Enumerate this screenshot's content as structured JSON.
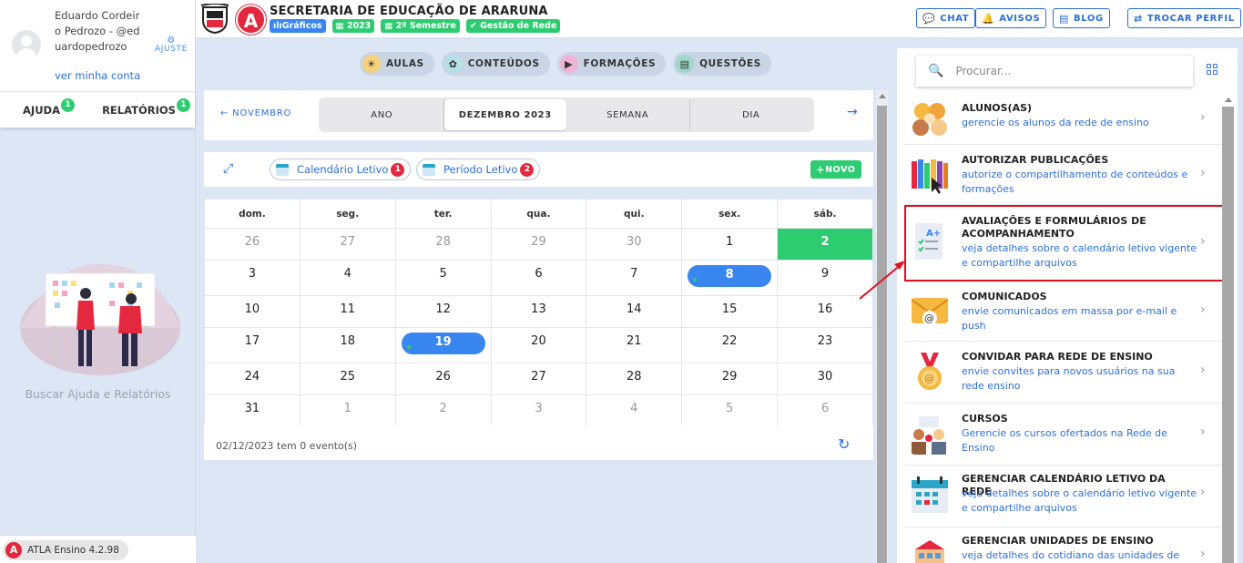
{
  "user": {
    "name_line": "Eduardo Cordeiro Pedrozo - @eduardopedrozo",
    "account_link": "ver minha conta",
    "adjust_label": "AJUSTE"
  },
  "left_tabs": [
    {
      "label": "AJUDA",
      "badge": "1"
    },
    {
      "label": "RELATÓRIOS",
      "badge": "1"
    }
  ],
  "left_help_text": "Buscar Ajuda e Relatórios",
  "version_label": "ATLA Ensino 4.2.98",
  "header": {
    "logo_letter": "A",
    "title": "SECRETARIA DE EDUCAÇÃO DE ARARUNA",
    "badges": [
      "Gráficos",
      "2023",
      "2º Semestre",
      "Gestão de Rede"
    ],
    "buttons": [
      "CHAT",
      "AVISOS",
      "BLOG",
      "TROCAR PERFIL"
    ]
  },
  "content_tabs": [
    "AULAS",
    "CONTEÚDOS",
    "FORMAÇÕES",
    "QUESTÕES"
  ],
  "calendar": {
    "prev_label": "NOVEMBRO",
    "view_segments": [
      "ANO",
      "DEZEMBRO 2023",
      "SEMANA",
      "DIA"
    ],
    "active_segment": "DEZEMBRO 2023",
    "chips": [
      {
        "label": "Calendário Letivo",
        "badge": "1"
      },
      {
        "label": "Período Letivo",
        "badge": "2"
      }
    ],
    "new_label": "NOVO",
    "weekdays": [
      "dom.",
      "seg.",
      "ter.",
      "qua.",
      "qui.",
      "sex.",
      "sáb."
    ],
    "weeks": [
      [
        "26",
        "27",
        "28",
        "29",
        "30",
        "1",
        "2"
      ],
      [
        "3",
        "4",
        "5",
        "6",
        "7",
        "8",
        "9"
      ],
      [
        "10",
        "11",
        "12",
        "13",
        "14",
        "15",
        "16"
      ],
      [
        "17",
        "18",
        "19",
        "20",
        "21",
        "22",
        "23"
      ],
      [
        "24",
        "25",
        "26",
        "27",
        "28",
        "29",
        "30"
      ],
      [
        "31",
        "1",
        "2",
        "3",
        "4",
        "5",
        "6"
      ]
    ],
    "status_text": "02/12/2023 tem 0 evento(s)"
  },
  "right_panel": {
    "search_placeholder": "Procurar...",
    "items": [
      {
        "title": "ALUNOS(AS)",
        "desc": "gerencie os alunos da rede de ensino",
        "icon": "students-icon"
      },
      {
        "title": "AUTORIZAR PUBLICAÇÕES",
        "desc": "autorize o compartilhamento de conteúdos e formações",
        "icon": "books-icon"
      },
      {
        "title": "AVALIAÇÕES E FORMULÁRIOS DE ACOMPANHAMENTO",
        "desc": "veja detalhes sobre o calendário letivo vigente e compartilhe arquivos",
        "icon": "evaluation-form-icon"
      },
      {
        "title": "COMUNICADOS",
        "desc": "envie comunicados em massa por e-mail e push",
        "icon": "email-icon"
      },
      {
        "title": "CONVIDAR PARA REDE DE ENSINO",
        "desc": "envie convites para novos usuários na sua rede ensino",
        "icon": "medal-icon"
      },
      {
        "title": "CURSOS",
        "desc": "Gerencie os cursos ofertados na Rede de Ensino",
        "icon": "courses-icon"
      },
      {
        "title": "GERENCIAR CALENDÁRIO LETIVO DA REDE",
        "desc": "veja detalhes sobre o calendário letivo vigente e compartilhe arquivos",
        "icon": "calendar-icon"
      },
      {
        "title": "GERENCIAR UNIDADES DE ENSINO",
        "desc": "veja detalhes do cotidiano das unidades de",
        "icon": "school-building-icon"
      }
    ]
  },
  "colors": {
    "accent_blue": "#2d6fdb",
    "brand_red": "#e3283f",
    "success_green": "#2ecc71",
    "highlight_red": "#e3101c"
  }
}
